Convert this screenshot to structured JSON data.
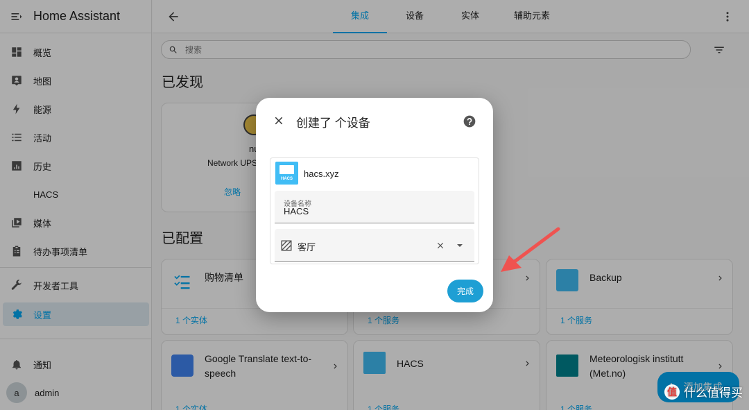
{
  "app": {
    "title": "Home Assistant"
  },
  "sidebar": {
    "items": [
      {
        "label": "概览",
        "icon": "dashboard-icon"
      },
      {
        "label": "地图",
        "icon": "map-icon"
      },
      {
        "label": "能源",
        "icon": "lightning-icon"
      },
      {
        "label": "活动",
        "icon": "list-icon"
      },
      {
        "label": "历史",
        "icon": "chart-icon"
      },
      {
        "label": "HACS",
        "icon": ""
      },
      {
        "label": "媒体",
        "icon": "media-icon"
      },
      {
        "label": "待办事项清单",
        "icon": "clipboard-icon"
      }
    ],
    "dev_tools": "开发者工具",
    "settings": "设置",
    "notifications": "通知",
    "user": {
      "initial": "a",
      "name": "admin"
    }
  },
  "topbar": {
    "tabs": [
      "集成",
      "设备",
      "实体",
      "辅助元素"
    ],
    "active_tab": "集成"
  },
  "search": {
    "placeholder": "搜索"
  },
  "discovered": {
    "title": "已发现",
    "card": {
      "name": "nu",
      "subtitle": "Network UPS",
      "ignore": "忽略"
    }
  },
  "configured": {
    "title": "已配置",
    "cards": [
      {
        "name": "购物清单",
        "link": "1 个实体"
      },
      {
        "name": "",
        "link": "1 个服务"
      },
      {
        "name": "Backup",
        "link": "1 个服务"
      },
      {
        "name": "Google Translate text-to-speech",
        "link": "1 个实体"
      },
      {
        "name": "HACS",
        "link": "1 个服务"
      },
      {
        "name": "Meteorologisk institutt (Met.no)",
        "link": "1 个服务"
      }
    ]
  },
  "fab": {
    "label": "添加集成"
  },
  "dialog": {
    "title": "创建了 个设备",
    "device_name": "hacs.xyz",
    "logo_text": "HACS",
    "field_label": "设备名称",
    "field_value": "HACS",
    "area_value": "客厅",
    "done": "完成"
  },
  "watermark": {
    "text": "什么值得买",
    "badge": "值"
  },
  "colors": {
    "accent": "#03a9f4",
    "arrow": "#ef5350"
  }
}
